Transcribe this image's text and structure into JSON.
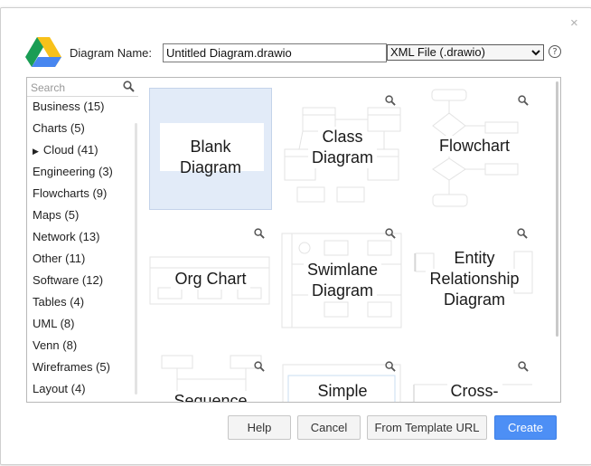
{
  "dialog": {
    "close_glyph": "×",
    "diagram_name_label": "Diagram Name:",
    "diagram_name_value": "Untitled Diagram.drawio",
    "format_select_value": "XML File (.drawio)",
    "help_glyph": "?",
    "logo_icon": "google-drive-logo"
  },
  "sidebar": {
    "search_placeholder": "Search",
    "categories": [
      {
        "label": "Business (15)"
      },
      {
        "label": "Charts (5)"
      },
      {
        "label": "Cloud (41)",
        "expandable": true,
        "arrow": "▶"
      },
      {
        "label": "Engineering (3)"
      },
      {
        "label": "Flowcharts (9)"
      },
      {
        "label": "Maps (5)"
      },
      {
        "label": "Network (13)"
      },
      {
        "label": "Other (11)"
      },
      {
        "label": "Software (12)"
      },
      {
        "label": "Tables (4)"
      },
      {
        "label": "UML (8)"
      },
      {
        "label": "Venn (8)"
      },
      {
        "label": "Wireframes (5)"
      },
      {
        "label": "Layout (4)"
      }
    ]
  },
  "templates": [
    {
      "label_lines": [
        "Blank",
        "Diagram"
      ],
      "selected": true
    },
    {
      "label_lines": [
        "Class",
        "Diagram"
      ]
    },
    {
      "label_lines": [
        "Flowchart"
      ]
    },
    {
      "label_lines": [
        "Org Chart"
      ]
    },
    {
      "label_lines": [
        "Swimlane",
        "Diagram"
      ]
    },
    {
      "label_lines": [
        "Entity",
        "Relationship",
        "Diagram"
      ]
    },
    {
      "label_lines": [
        "Sequence"
      ]
    },
    {
      "label_lines": [
        "Simple"
      ]
    },
    {
      "label_lines": [
        "Cross-"
      ]
    }
  ],
  "buttons": {
    "help": "Help",
    "cancel": "Cancel",
    "from_template_url": "From Template URL",
    "create": "Create"
  },
  "colors": {
    "accent": "#4d8ff5",
    "selected_tile": "#e2ebf8"
  }
}
